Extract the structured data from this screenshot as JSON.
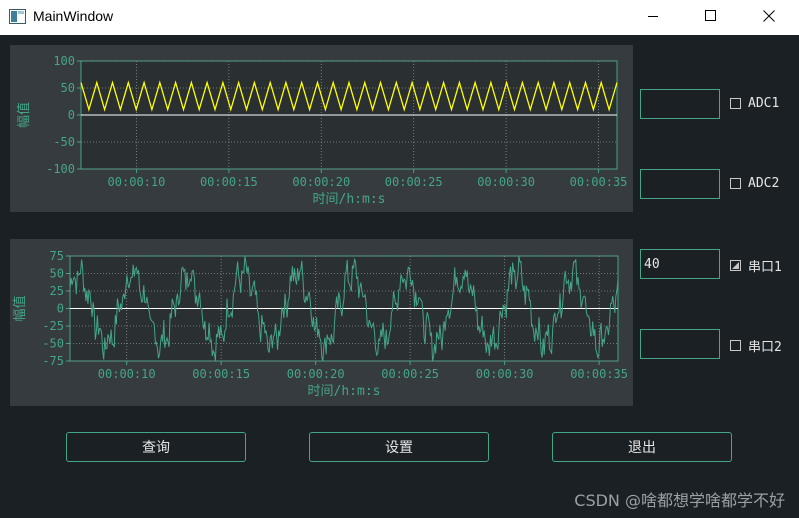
{
  "window": {
    "title": "MainWindow",
    "icon": "app-window-icon",
    "controls": [
      "minimize-icon",
      "maximize-icon",
      "close-icon"
    ]
  },
  "charts": [
    {
      "y_title": "幅值",
      "x_title": "时间/h:m:s",
      "y_ticks": [
        "100",
        "50",
        "0",
        "-50",
        "-100"
      ],
      "x_ticks": [
        "00:00:10",
        "00:00:15",
        "00:00:20",
        "00:00:25",
        "00:00:30",
        "00:00:35"
      ],
      "line_color": "#ffff00",
      "baseline_color": "#ffffff"
    },
    {
      "y_title": "幅值",
      "x_title": "时间/h:m:s",
      "y_ticks": [
        "75",
        "50",
        "25",
        "0",
        "-25",
        "-50",
        "-75"
      ],
      "x_ticks": [
        "00:00:10",
        "00:00:15",
        "00:00:20",
        "00:00:25",
        "00:00:30",
        "00:00:35"
      ],
      "line_color": "#45a587",
      "baseline_color": "#ffffff"
    }
  ],
  "chart_data": [
    {
      "type": "line",
      "x_range": [
        "00:00:07",
        "00:00:36"
      ],
      "ylim": [
        -100,
        100
      ],
      "grid": true,
      "series": [
        {
          "waveform": "triangle",
          "min": 10,
          "max": 60,
          "cycles": 34,
          "color": "#ffff00"
        }
      ]
    },
    {
      "type": "line",
      "x_range": [
        "00:00:07",
        "00:00:36"
      ],
      "ylim": [
        -75,
        75
      ],
      "grid": true,
      "series": [
        {
          "waveform": "noisy-sine",
          "amplitude": 50,
          "noise": 20,
          "cycles": 10,
          "color": "#45a587"
        }
      ]
    }
  ],
  "side": {
    "inputs": [
      "",
      "",
      "40",
      ""
    ],
    "checks": [
      {
        "label": "ADC1",
        "checked": false
      },
      {
        "label": "ADC2",
        "checked": false
      },
      {
        "label": "串口1",
        "checked": true
      },
      {
        "label": "串口2",
        "checked": false
      }
    ]
  },
  "buttons": {
    "query": "查询",
    "settings": "设置",
    "exit": "退出"
  },
  "watermark": "CSDN @啥都想学啥都学不好",
  "colors": {
    "accent": "#45a587",
    "background": "#1b2024",
    "panel": "#353b3e",
    "plot": "#2a2f32"
  }
}
